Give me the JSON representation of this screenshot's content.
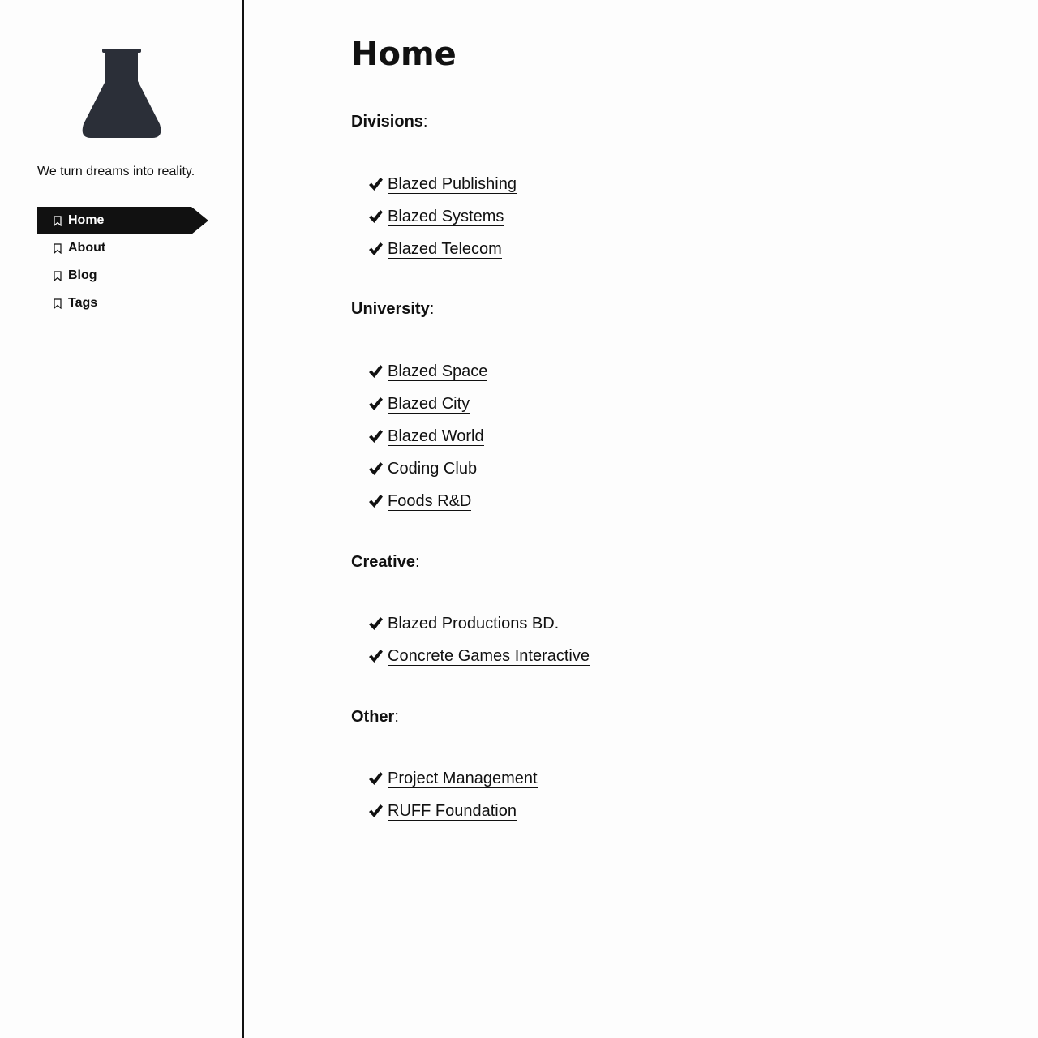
{
  "sidebar": {
    "logo_icon": "flask-icon",
    "tagline": "We turn dreams into reality.",
    "nav": [
      {
        "label": "Home",
        "icon": "bookmark-icon",
        "active": true
      },
      {
        "label": "About",
        "icon": "bookmark-icon",
        "active": false
      },
      {
        "label": "Blog",
        "icon": "bookmark-icon",
        "active": false
      },
      {
        "label": "Tags",
        "icon": "bookmark-icon",
        "active": false
      }
    ]
  },
  "main": {
    "title": "Home",
    "sections": [
      {
        "heading": "Divisions",
        "links": [
          "Blazed Publishing",
          "Blazed Systems",
          "Blazed Telecom"
        ]
      },
      {
        "heading": "University",
        "links": [
          "Blazed Space",
          "Blazed City",
          "Blazed World",
          "Coding Club",
          "Foods R&D"
        ]
      },
      {
        "heading": "Creative",
        "links": [
          "Blazed Productions BD.",
          "Concrete Games Interactive"
        ]
      },
      {
        "heading": "Other",
        "links": [
          "Project Management",
          "RUFF Foundation"
        ]
      }
    ]
  },
  "colors": {
    "text": "#111111",
    "background": "#fdfdfd",
    "logo": "#2b2f38"
  }
}
